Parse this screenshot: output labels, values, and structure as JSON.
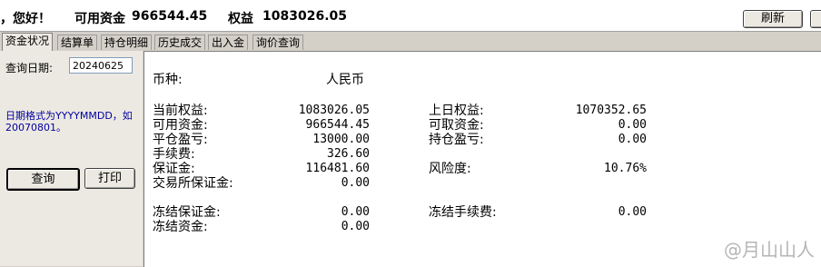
{
  "header": {
    "greeting": "，您好！",
    "available_label": "可用资金",
    "available_value": "966544.45",
    "equity_label": "权益",
    "equity_value": "1083026.05",
    "refresh_button": "刷新"
  },
  "tabs": [
    "资金状况",
    "结算单",
    "持仓明细",
    "历史成交",
    "出入金",
    "询价查询"
  ],
  "left": {
    "query_date_label": "查询日期:",
    "query_date_value": "20240625",
    "hint": "日期格式为YYYYMMDD，如20070801。",
    "query_button": "查询",
    "print_button": "打印"
  },
  "panel": {
    "currency_label": "币种:",
    "currency_value": "人民币",
    "rows_left": [
      {
        "label": "当前权益:",
        "value": "1083026.05"
      },
      {
        "label": "可用资金:",
        "value": "966544.45"
      },
      {
        "label": "平仓盈亏:",
        "value": "13000.00"
      },
      {
        "label": "手续费:",
        "value": "326.60"
      },
      {
        "label": "保证金:",
        "value": "116481.60"
      },
      {
        "label": "交易所保证金:",
        "value": "0.00"
      }
    ],
    "rows_right": [
      {
        "label": "上日权益:",
        "value": "1070352.65"
      },
      {
        "label": "可取资金:",
        "value": "0.00"
      },
      {
        "label": "持仓盈亏:",
        "value": "0.00"
      },
      {
        "label": "风险度:",
        "value": "10.76%"
      }
    ],
    "frozen_left": [
      {
        "label": "冻结保证金:",
        "value": "0.00"
      },
      {
        "label": "冻结资金:",
        "value": "0.00"
      }
    ],
    "frozen_right": [
      {
        "label": "冻结手续费:",
        "value": "0.00"
      }
    ],
    "watermark": "@月山山人"
  }
}
